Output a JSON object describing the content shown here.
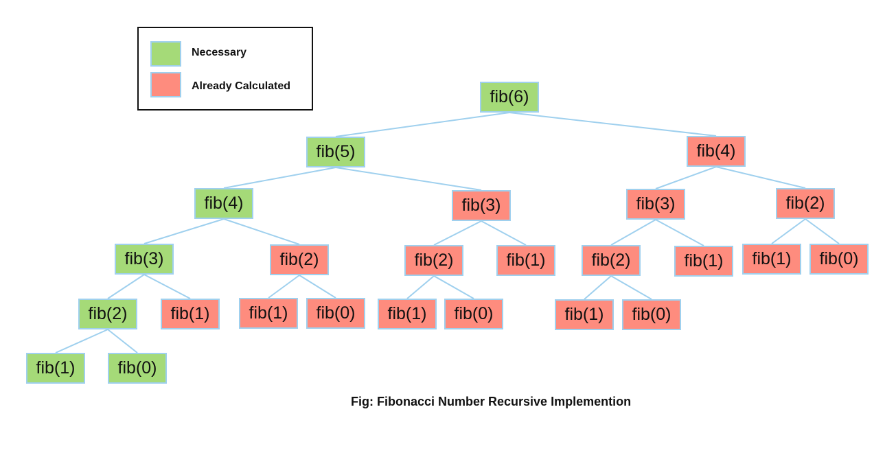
{
  "legend": {
    "items": [
      {
        "label": "Necessary",
        "color": "#a5da78"
      },
      {
        "label": "Already Calculated",
        "color": "#fe8c7e"
      }
    ]
  },
  "colors": {
    "necessary": "#a5da78",
    "already_calculated": "#fe8c7e",
    "edge": "#9fd0ee",
    "node_border": "#9fd0ee"
  },
  "caption": "Fig: Fibonacci Number Recursive Implemention",
  "tree": {
    "nodes": [
      {
        "id": "n0",
        "label": "fib(6)",
        "status": "necessary",
        "parent": null
      },
      {
        "id": "n1",
        "label": "fib(5)",
        "status": "necessary",
        "parent": "n0"
      },
      {
        "id": "n2",
        "label": "fib(4)",
        "status": "calculated",
        "parent": "n0"
      },
      {
        "id": "n3",
        "label": "fib(4)",
        "status": "necessary",
        "parent": "n1"
      },
      {
        "id": "n4",
        "label": "fib(3)",
        "status": "calculated",
        "parent": "n1"
      },
      {
        "id": "n5",
        "label": "fib(3)",
        "status": "calculated",
        "parent": "n2"
      },
      {
        "id": "n6",
        "label": "fib(2)",
        "status": "calculated",
        "parent": "n2"
      },
      {
        "id": "n7",
        "label": "fib(3)",
        "status": "necessary",
        "parent": "n3"
      },
      {
        "id": "n8",
        "label": "fib(2)",
        "status": "calculated",
        "parent": "n3"
      },
      {
        "id": "n9",
        "label": "fib(2)",
        "status": "calculated",
        "parent": "n4"
      },
      {
        "id": "n10",
        "label": "fib(1)",
        "status": "calculated",
        "parent": "n4"
      },
      {
        "id": "n11",
        "label": "fib(2)",
        "status": "calculated",
        "parent": "n5"
      },
      {
        "id": "n12",
        "label": "fib(1)",
        "status": "calculated",
        "parent": "n5"
      },
      {
        "id": "n13",
        "label": "fib(1)",
        "status": "calculated",
        "parent": "n6"
      },
      {
        "id": "n14",
        "label": "fib(0)",
        "status": "calculated",
        "parent": "n6"
      },
      {
        "id": "n15",
        "label": "fib(2)",
        "status": "necessary",
        "parent": "n7"
      },
      {
        "id": "n16",
        "label": "fib(1)",
        "status": "calculated",
        "parent": "n7"
      },
      {
        "id": "n17",
        "label": "fib(1)",
        "status": "calculated",
        "parent": "n8"
      },
      {
        "id": "n18",
        "label": "fib(0)",
        "status": "calculated",
        "parent": "n8"
      },
      {
        "id": "n19",
        "label": "fib(1)",
        "status": "calculated",
        "parent": "n9"
      },
      {
        "id": "n20",
        "label": "fib(0)",
        "status": "calculated",
        "parent": "n9"
      },
      {
        "id": "n21",
        "label": "fib(1)",
        "status": "calculated",
        "parent": "n11"
      },
      {
        "id": "n22",
        "label": "fib(0)",
        "status": "calculated",
        "parent": "n11"
      },
      {
        "id": "n23",
        "label": "fib(1)",
        "status": "necessary",
        "parent": "n15"
      },
      {
        "id": "n24",
        "label": "fib(0)",
        "status": "necessary",
        "parent": "n15"
      }
    ]
  }
}
